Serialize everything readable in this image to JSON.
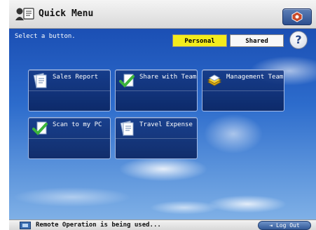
{
  "header": {
    "title": "Quick Menu",
    "icon": "quick-menu-icon",
    "settings_icon": "settings-icon"
  },
  "toolbar": {
    "instruction": "Select a button.",
    "personal_label": "Personal",
    "shared_label": "Shared",
    "help_label": "?"
  },
  "buttons": [
    {
      "label": "Sales Report",
      "icon": "document-icon"
    },
    {
      "label": "Share with Team",
      "icon": "green-check-icon"
    },
    {
      "label": "Management Team",
      "icon": "yellow-stack-icon"
    },
    {
      "label": "Scan to my PC",
      "icon": "green-check-icon"
    },
    {
      "label": "Travel Expense",
      "icon": "document-icon"
    }
  ],
  "status": {
    "text": "Remote Operation is being used...",
    "logout_label": "Log Out"
  },
  "colors": {
    "selected_tab": "#f4ec1c",
    "button_bg": "#0f3a86",
    "sky_top": "#1b4fb4"
  }
}
